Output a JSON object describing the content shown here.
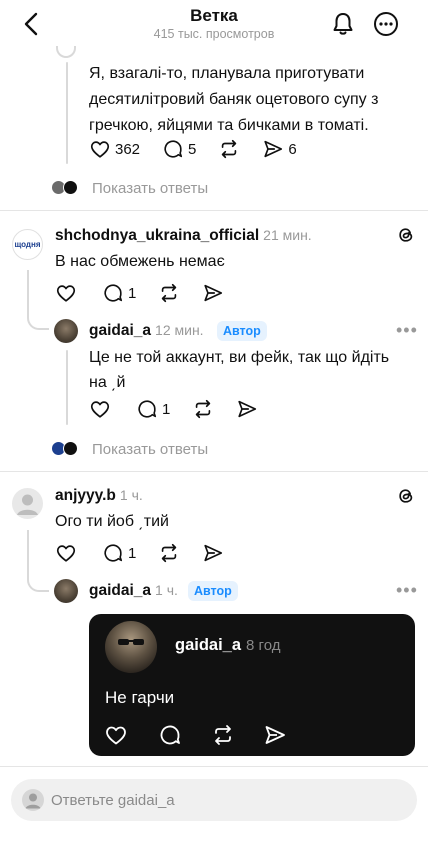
{
  "header": {
    "title": "Ветка",
    "subtitle": "415 тыс. просмотров"
  },
  "post_top": {
    "text": "Я, взагалі-то, планувала приготувати десятилітровий баняк оцетового супу з гречкою, яйцями та бичками в томаті.",
    "likes": "362",
    "comments": "5",
    "shares": "6",
    "show_replies": "Показать ответы"
  },
  "comment1": {
    "username": "shchodnya_ukraina_official",
    "time": "21 мин.",
    "avatar_text": "щодня",
    "text": "В нас обмежень немає",
    "comments": "1",
    "reply": {
      "username": "gaidai_a",
      "time": "12 мин.",
      "badge": "Автор",
      "text": "Це не той аккаунт, ви фейк, так що йдіть на ͵й",
      "comments": "1"
    },
    "show_replies": "Показать ответы"
  },
  "comment2": {
    "username": "anjyyy.b",
    "time": "1 ч.",
    "text": "Ого ти йоб ͵тий",
    "comments": "1",
    "reply": {
      "username": "gaidai_a",
      "time": "1 ч.",
      "badge": "Автор",
      "quote": {
        "username": "gaidai_a",
        "time": "8 год",
        "text": "Не гарчи"
      }
    }
  },
  "reply_box": {
    "placeholder": "Ответьте gaidai_a"
  },
  "colors": {
    "badge_bg": "#e6f2fe",
    "badge_text": "#1a8cff",
    "secondary_text": "#999999",
    "quote_card_bg": "#111111"
  }
}
